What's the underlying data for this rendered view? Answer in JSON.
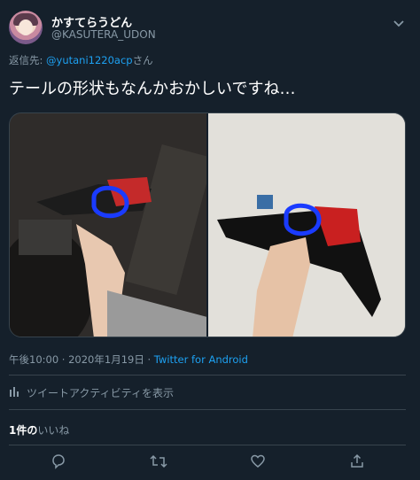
{
  "user": {
    "name": "かすてらうどん",
    "handle": "@KASUTERA_UDON"
  },
  "reply": {
    "prefix": "返信先: ",
    "mention": "@yutani1220acp",
    "suffix": "さん"
  },
  "tweet": {
    "text": "テールの形状もなんかおかしいですね…"
  },
  "media": {
    "photos": [
      "tail-light-on-bike",
      "tail-light-held-in-hand"
    ],
    "highlight_color": "#1a3bff"
  },
  "meta": {
    "time": "午後10:00 · 2020年1月19日 · ",
    "app": "Twitter for Android"
  },
  "activity": {
    "label": "ツイートアクティビティを表示"
  },
  "likes": {
    "count": "1件の",
    "label": "いいね"
  },
  "colors": {
    "background": "#15202b",
    "accent": "#1da1f2",
    "secondary_text": "#8899a6",
    "divider": "#38444d"
  },
  "icons": [
    "chevron-down-icon",
    "bar-chart-icon",
    "reply-icon",
    "retweet-icon",
    "like-icon",
    "share-icon"
  ]
}
